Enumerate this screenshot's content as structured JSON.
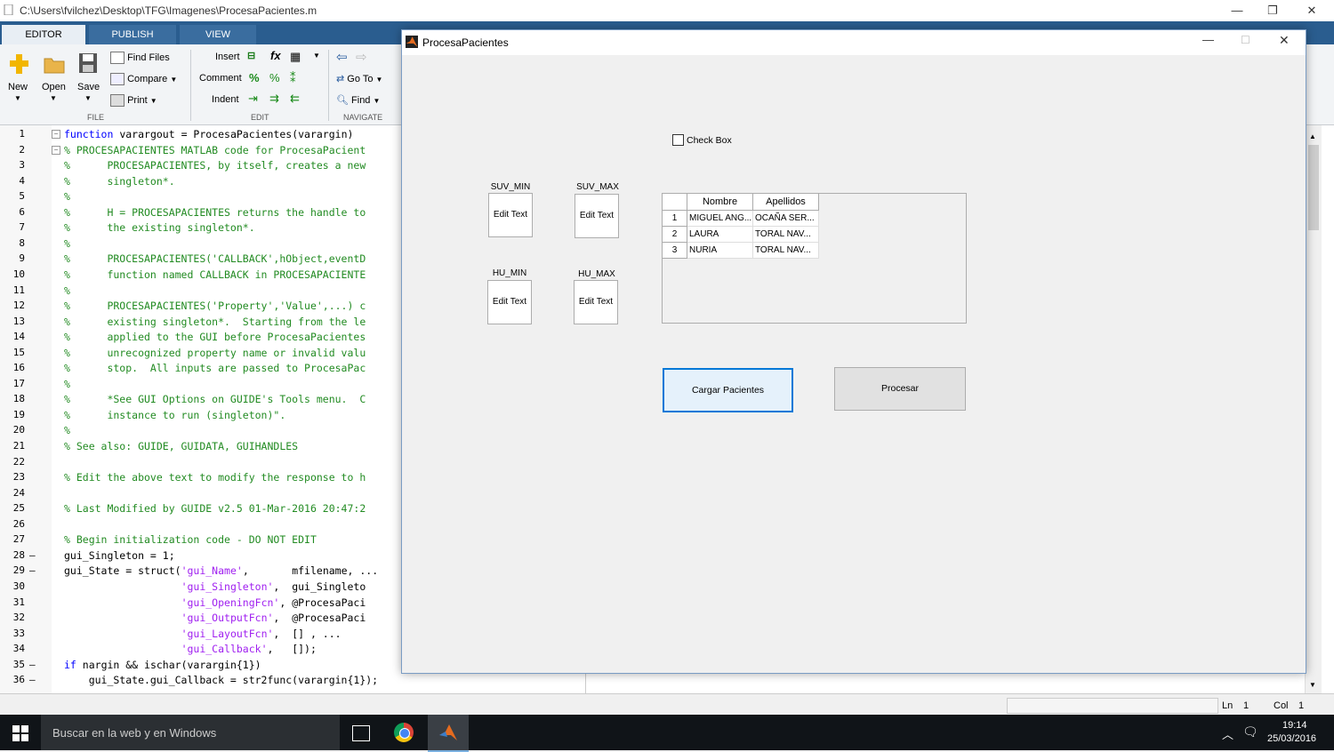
{
  "editor_window": {
    "title": "C:\\Users\\fvilchez\\Desktop\\TFG\\Imagenes\\ProcesaPacientes.m",
    "minimize": "—",
    "restore": "❐",
    "close": "✕"
  },
  "ribbon": {
    "tabs": [
      "EDITOR",
      "PUBLISH",
      "VIEW"
    ],
    "file": {
      "new": "New",
      "open": "Open",
      "save": "Save",
      "find_files": "Find Files",
      "compare": "Compare",
      "print": "Print",
      "label": "FILE"
    },
    "edit": {
      "insert": "Insert",
      "comment": "Comment",
      "indent": "Indent",
      "label": "EDIT"
    },
    "navigate": {
      "go_to": "Go To",
      "find": "Find",
      "label": "NAVIGATE"
    }
  },
  "code_lines": [
    {
      "n": "1",
      "dash": "",
      "text": "function varargout = ProcesaPacientes(varargin)",
      "type": "fn"
    },
    {
      "n": "2",
      "dash": "",
      "text": "% PROCESAPACIENTES MATLAB code for ProcesaPacient",
      "type": "c"
    },
    {
      "n": "3",
      "dash": "",
      "text": "%      PROCESAPACIENTES, by itself, creates a new",
      "type": "c"
    },
    {
      "n": "4",
      "dash": "",
      "text": "%      singleton*.",
      "type": "c"
    },
    {
      "n": "5",
      "dash": "",
      "text": "%",
      "type": "c"
    },
    {
      "n": "6",
      "dash": "",
      "text": "%      H = PROCESAPACIENTES returns the handle to",
      "type": "c"
    },
    {
      "n": "7",
      "dash": "",
      "text": "%      the existing singleton*.",
      "type": "c"
    },
    {
      "n": "8",
      "dash": "",
      "text": "%",
      "type": "c"
    },
    {
      "n": "9",
      "dash": "",
      "text": "%      PROCESAPACIENTES('CALLBACK',hObject,eventD",
      "type": "c"
    },
    {
      "n": "10",
      "dash": "",
      "text": "%      function named CALLBACK in PROCESAPACIENTE",
      "type": "c"
    },
    {
      "n": "11",
      "dash": "",
      "text": "%",
      "type": "c"
    },
    {
      "n": "12",
      "dash": "",
      "text": "%      PROCESAPACIENTES('Property','Value',...) c",
      "type": "c"
    },
    {
      "n": "13",
      "dash": "",
      "text": "%      existing singleton*.  Starting from the le",
      "type": "c"
    },
    {
      "n": "14",
      "dash": "",
      "text": "%      applied to the GUI before ProcesaPacientes",
      "type": "c"
    },
    {
      "n": "15",
      "dash": "",
      "text": "%      unrecognized property name or invalid valu",
      "type": "c"
    },
    {
      "n": "16",
      "dash": "",
      "text": "%      stop.  All inputs are passed to ProcesaPac",
      "type": "c"
    },
    {
      "n": "17",
      "dash": "",
      "text": "%",
      "type": "c"
    },
    {
      "n": "18",
      "dash": "",
      "text": "%      *See GUI Options on GUIDE's Tools menu.  C",
      "type": "c"
    },
    {
      "n": "19",
      "dash": "",
      "text": "%      instance to run (singleton)\".",
      "type": "c"
    },
    {
      "n": "20",
      "dash": "",
      "text": "%",
      "type": "c"
    },
    {
      "n": "21",
      "dash": "",
      "text": "% See also: GUIDE, GUIDATA, GUIHANDLES",
      "type": "c"
    },
    {
      "n": "22",
      "dash": "",
      "text": "",
      "type": "c"
    },
    {
      "n": "23",
      "dash": "",
      "text": "% Edit the above text to modify the response to h",
      "type": "c"
    },
    {
      "n": "24",
      "dash": "",
      "text": "",
      "type": "c"
    },
    {
      "n": "25",
      "dash": "",
      "text": "% Last Modified by GUIDE v2.5 01-Mar-2016 20:47:2",
      "type": "c"
    },
    {
      "n": "26",
      "dash": "",
      "text": "",
      "type": "c"
    },
    {
      "n": "27",
      "dash": "",
      "text": "% Begin initialization code - DO NOT EDIT",
      "type": "c"
    },
    {
      "n": "28",
      "dash": "—",
      "text": "gui_Singleton = 1;",
      "type": "k"
    },
    {
      "n": "29",
      "dash": "—",
      "text": "gui_State = struct(",
      "type": "s29"
    },
    {
      "n": "30",
      "dash": "",
      "text": "                   ",
      "type": "s30"
    },
    {
      "n": "31",
      "dash": "",
      "text": "",
      "type": "s31"
    },
    {
      "n": "32",
      "dash": "",
      "text": "",
      "type": "s32"
    },
    {
      "n": "33",
      "dash": "",
      "text": "",
      "type": "s33"
    },
    {
      "n": "34",
      "dash": "",
      "text": "",
      "type": "s34"
    },
    {
      "n": "35",
      "dash": "—",
      "text": "nargin && ischar(varargin{1})",
      "type": "if"
    },
    {
      "n": "36",
      "dash": "—",
      "text": "    gui_State.gui_Callback = str2func(varargin{1});",
      "type": "k"
    }
  ],
  "struct_lines": {
    "l29_str": "'gui_Name'",
    "l29_rest": ",       mfilename, ...",
    "l30_str": "'gui_Singleton'",
    "l30_rest": ",  gui_Singleto",
    "l31_str": "'gui_OpeningFcn'",
    "l31_rest": ", @ProcesaPaci",
    "l32_str": "'gui_OutputFcn'",
    "l32_rest": ",  @ProcesaPaci",
    "l33_str": "'gui_LayoutFcn'",
    "l33_rest": ",  [] , ...",
    "l34_str": "'gui_Callback'",
    "l34_rest": ",   []);",
    "kw_if": "if"
  },
  "status_bar": {
    "ln_label": "Ln",
    "ln_value": "1",
    "col_label": "Col",
    "col_value": "1"
  },
  "taskbar": {
    "search_placeholder": "Buscar en la web y en Windows",
    "time": "19:14",
    "date": "25/03/2016"
  },
  "figure": {
    "title": "ProcesaPacientes",
    "checkbox_label": "Check Box",
    "suv_min_label": "SUV_MIN",
    "suv_max_label": "SUV_MAX",
    "hu_min_label": "HU_MIN",
    "hu_max_label": "HU_MAX",
    "edit_text": "Edit Text",
    "table": {
      "columns": [
        "Nombre",
        "Apellidos"
      ],
      "rows": [
        {
          "idx": "1",
          "nombre": "MIGUEL ANG...",
          "apellidos": "OCAÑA SER..."
        },
        {
          "idx": "2",
          "nombre": "LAURA",
          "apellidos": "TORAL NAV..."
        },
        {
          "idx": "3",
          "nombre": "NURIA",
          "apellidos": "TORAL NAV..."
        }
      ]
    },
    "cargar_button": "Cargar Pacientes",
    "procesar_button": "Procesar"
  }
}
